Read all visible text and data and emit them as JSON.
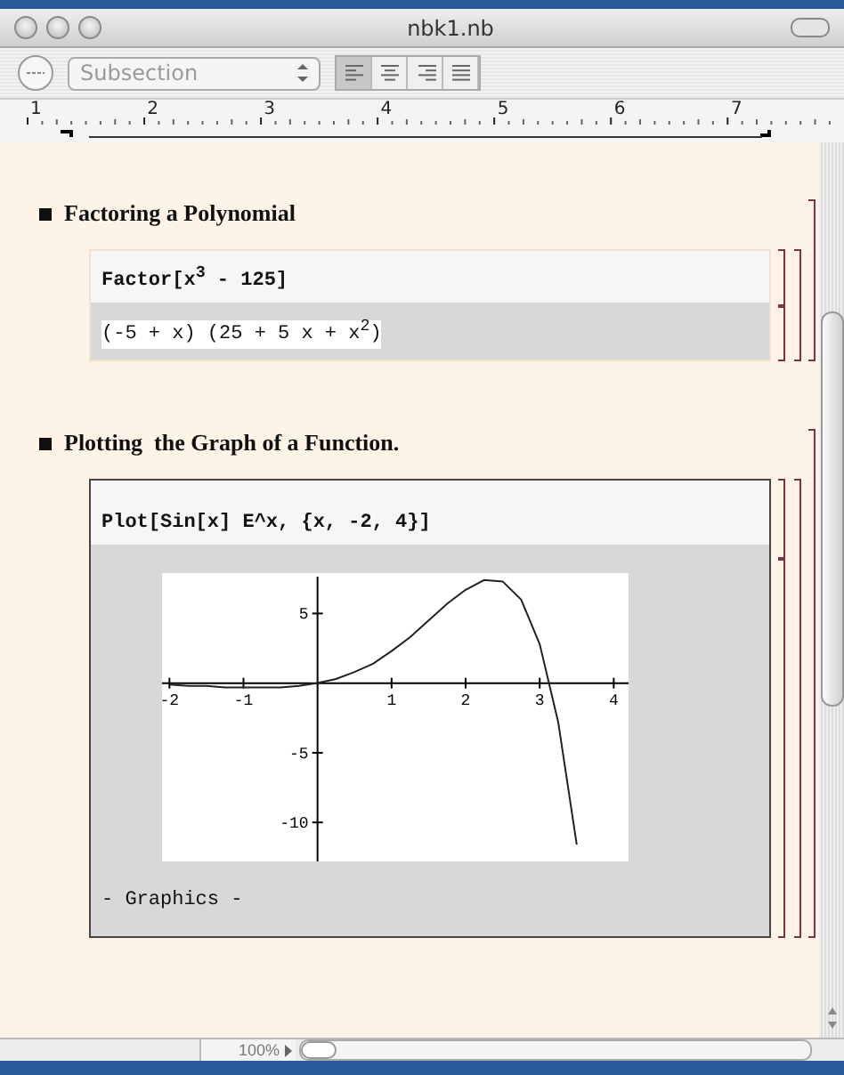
{
  "window": {
    "title": "nbk1.nb"
  },
  "toolbar": {
    "style_menu": "Subsection",
    "align_buttons": [
      {
        "kind": "left",
        "selected": true
      },
      {
        "kind": "center",
        "selected": false
      },
      {
        "kind": "right",
        "selected": false
      },
      {
        "kind": "justify",
        "selected": false
      }
    ]
  },
  "ruler": {
    "marks": [
      "1",
      "2",
      "3",
      "4",
      "5",
      "6",
      "7"
    ]
  },
  "sections": [
    {
      "title": "Factoring a Polynomial",
      "selected": false,
      "input": "Factor[x$^{3}$ - 125]",
      "output": "(-5 + x) (25 + 5 x + x$^{2}$)"
    },
    {
      "title": "Plotting  the Graph of a Function.",
      "selected": true,
      "input": "Plot[Sin[x] E^x, {x, -2, 4}]",
      "output_label": "- Graphics -",
      "chart_data": {
        "type": "line",
        "x": [
          -2,
          -1.75,
          -1.5,
          -1.25,
          -1,
          -0.75,
          -0.5,
          -0.25,
          0,
          0.25,
          0.5,
          0.75,
          1,
          1.25,
          1.5,
          1.75,
          2,
          2.25,
          2.5,
          2.75,
          3,
          3.25,
          3.5
        ],
        "series": [
          {
            "color": "#222222",
            "values": [
              -0.1,
              -0.2,
              -0.2,
              -0.3,
              -0.3,
              -0.3,
              -0.3,
              -0.2,
              0,
              0.3,
              0.8,
              1.4,
              2.3,
              3.3,
              4.5,
              5.7,
              6.7,
              7.4,
              7.3,
              6,
              2.8,
              -2.8,
              -11.6
            ]
          }
        ],
        "xlim": [
          -2.1,
          4.2
        ],
        "ylim": [
          -12.8,
          7.9
        ],
        "xticks": [
          -2,
          -1,
          1,
          2,
          3,
          4
        ],
        "yticks": [
          5,
          -5,
          -10
        ]
      }
    }
  ],
  "status_bar": {
    "zoom": "100%"
  }
}
